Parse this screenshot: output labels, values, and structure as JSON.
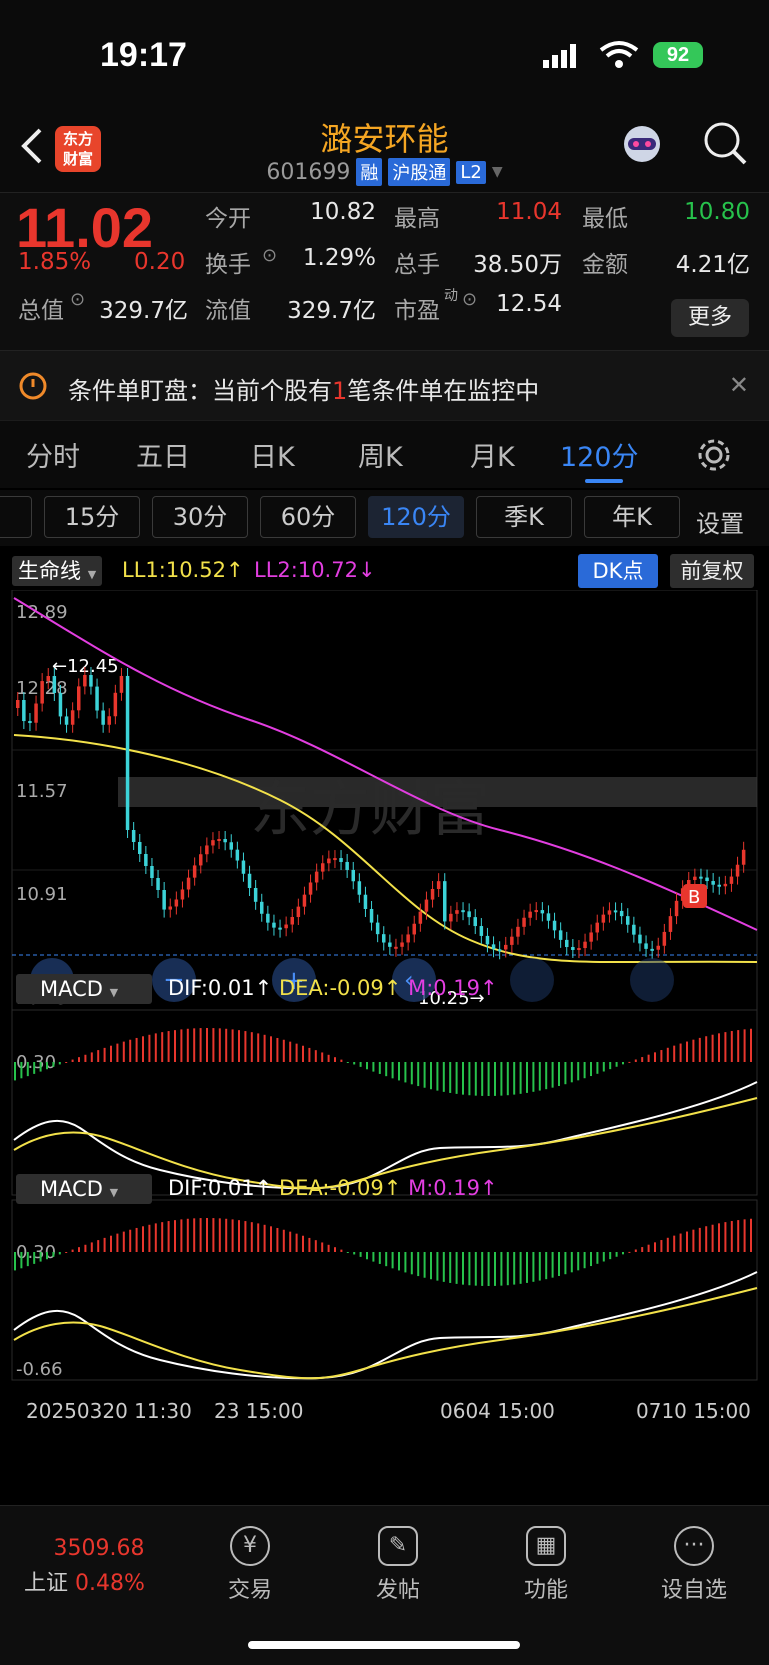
{
  "status_bar": {
    "time": "19:17",
    "battery": "92"
  },
  "header": {
    "logo": "东方\n财富",
    "stock_name": "潞安环能",
    "stock_code": "601699",
    "tags": [
      "融",
      "沪股通",
      "L2"
    ]
  },
  "quote": {
    "price": "11.02",
    "change_pct": "1.85%",
    "change": "0.20",
    "stats": [
      {
        "label": "今开",
        "value": "10.82",
        "color": "#e8e8e8"
      },
      {
        "label": "最高",
        "value": "11.04",
        "color": "#e8362d"
      },
      {
        "label": "最低",
        "value": "10.80",
        "color": "#27c24c"
      },
      {
        "label": "换手",
        "value": "1.29%",
        "color": "#e8e8e8"
      },
      {
        "label": "总手",
        "value": "38.50万",
        "color": "#e8e8e8"
      },
      {
        "label": "金额",
        "value": "4.21亿",
        "color": "#e8e8e8"
      },
      {
        "label": "总值",
        "value": "329.7亿",
        "color": "#e8e8e8"
      },
      {
        "label": "流值",
        "value": "329.7亿",
        "color": "#e8e8e8"
      },
      {
        "label": "市盈",
        "value": "12.54",
        "color": "#e8e8e8"
      }
    ],
    "pe_sup": "动",
    "more": "更多"
  },
  "notice": {
    "prefix": "条件单盯盘：当前个股有",
    "count": "1",
    "suffix": "笔条件单在监控中"
  },
  "tabs": [
    "分时",
    "五日",
    "日K",
    "周K",
    "月K",
    "120分"
  ],
  "periods": [
    "15分",
    "30分",
    "60分",
    "120分",
    "季K",
    "年K"
  ],
  "settings_label": "设置",
  "kline": {
    "indicator": "生命线",
    "ll1": "LL1:10.52",
    "ll2": "LL2:10.72",
    "dk_button": "DK点",
    "adjust_button": "前复权",
    "price_labels": [
      "12.89",
      "12.28",
      "11.57",
      "10.91",
      "10.25"
    ],
    "high_marker": "←12.45",
    "low_marker": "10.25→",
    "watermark": "东方财富"
  },
  "macd": {
    "name": "MACD",
    "dif": "DIF:0.01",
    "dea": "DEA:-0.09",
    "m": "M:0.19",
    "top": "0.30",
    "bottom": "-0.66"
  },
  "time_axis": [
    "20250320 11:30",
    "23 15:00",
    "0604 15:00",
    "0710 15:00"
  ],
  "bottom_nav": {
    "index_value": "3509.68",
    "index_name": "上证",
    "index_change": "0.48%",
    "items": [
      "交易",
      "发帖",
      "功能",
      "设自选"
    ]
  },
  "colors": {
    "up": "#e8362d",
    "down": "#3cd3d8",
    "ma1": "#f2e14a",
    "ma2": "#e23ee0",
    "accent": "#3a86f5"
  }
}
